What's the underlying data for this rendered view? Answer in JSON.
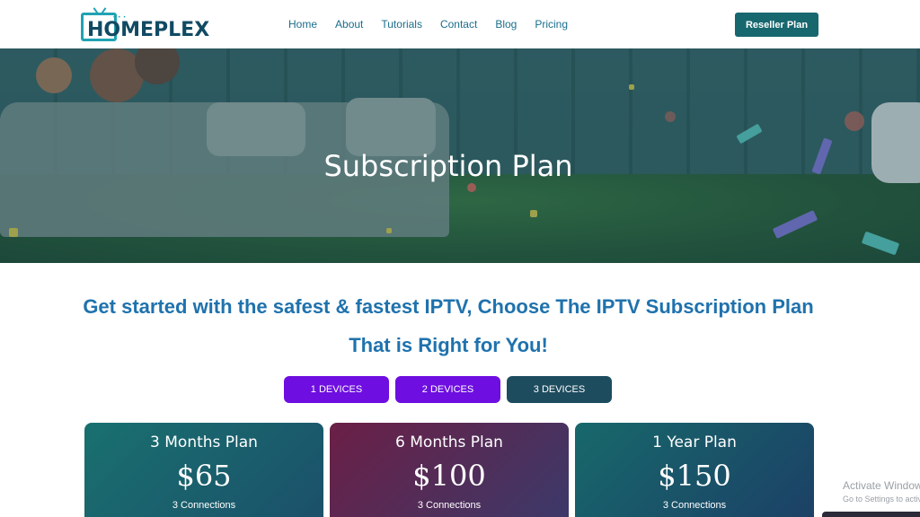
{
  "header": {
    "logo_text": "HOMEPLEX",
    "nav": [
      "Home",
      "About",
      "Tutorials",
      "Contact",
      "Blog",
      "Pricing"
    ],
    "reseller_label": "Reseller Plan"
  },
  "hero": {
    "title": "Subscription Plan"
  },
  "tagline": "Get started with the safest & fastest IPTV, Choose The IPTV Subscription Plan That is Right for You!",
  "device_tabs": [
    "1 DEVICES",
    "2 DEVICES",
    "3 DEVICES"
  ],
  "plans": [
    {
      "name": "3 Months Plan",
      "price": "$65",
      "connections": "3 Connections"
    },
    {
      "name": "6 Months Plan",
      "price": "$100",
      "connections": "3 Connections"
    },
    {
      "name": "1 Year Plan",
      "price": "$150",
      "connections": "3 Connections"
    }
  ],
  "watermark": {
    "title": "Activate Windows",
    "subtitle": "Go to Settings to activate Windows."
  },
  "colors": {
    "accent": "#1f72ad",
    "brand_dark": "#114a63",
    "reseller_button": "#17676f",
    "device_tab_purple": "#6e0ee0",
    "device_tab_dark": "#1d4c5e"
  },
  "icons": [
    "tv-logo-icon"
  ]
}
